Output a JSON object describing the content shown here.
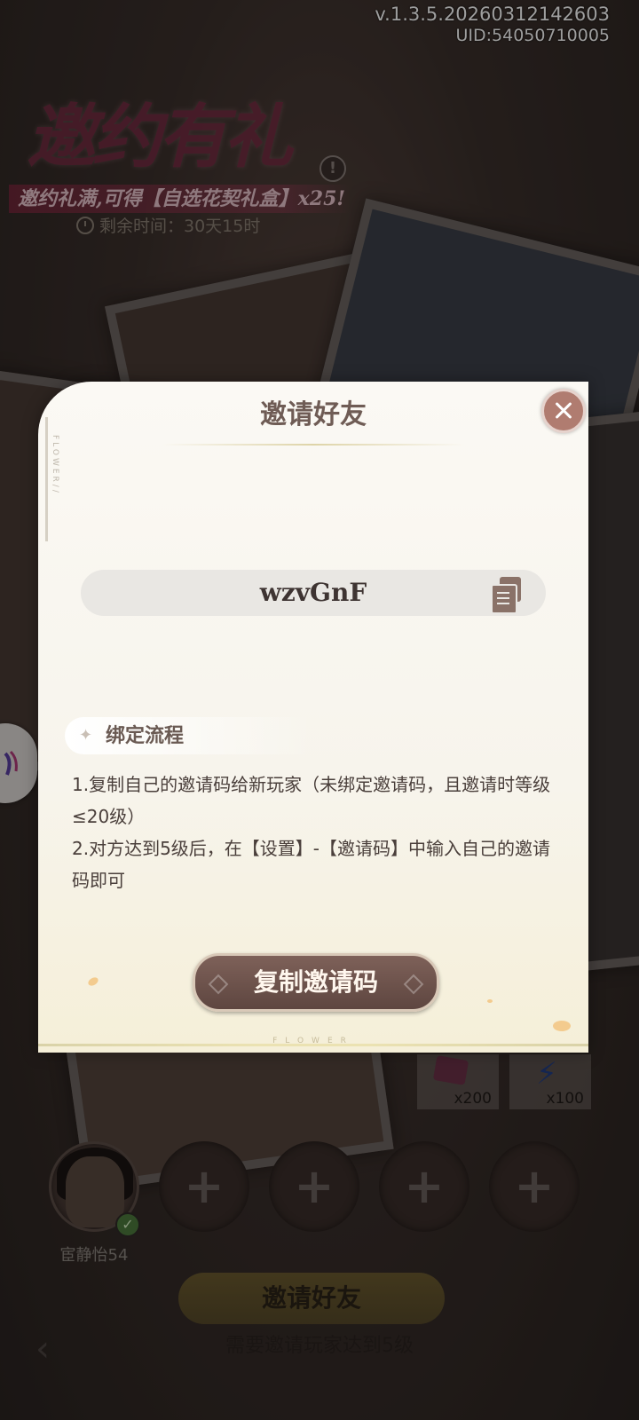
{
  "version": "v.1.3.5.20260312142603",
  "uid": "UID:54050710005",
  "event": {
    "title": "邀约有礼",
    "banner": "邀约礼满,可得【自选花契礼盒】x25!",
    "time_label": "剩余时间：30天15时",
    "alert": "!"
  },
  "rewards": [
    {
      "icon": "gem-icon",
      "qty": "x200"
    },
    {
      "icon": "energy-bolt-icon",
      "qty": "x100"
    }
  ],
  "player": {
    "name": "宦静怡54",
    "check": "✓"
  },
  "empty_slot_symbol": "+",
  "bottom": {
    "invite_label": "邀请好友",
    "note": "需要邀请玩家达到5级",
    "back_symbol": "‹"
  },
  "modal": {
    "title": "邀请好友",
    "side_mark": "FLOWER//",
    "footer_mark": "FLOWER",
    "invite_code": "wzvGnF",
    "section_title": "绑定流程",
    "section_icon": "✦",
    "steps": [
      "1.复制自己的邀请码给新玩家（未绑定邀请码，且邀请时等级≤20级）",
      " 2.对方达到5级后，在【设置】-【邀请码】中输入自己的邀请码即可"
    ],
    "copy_button_label": "复制邀请码"
  },
  "colors": {
    "modal_bg": "#fbf9f4",
    "button_brown": "#6e5149",
    "close_btn": "#b07c70",
    "title_text": "#6f5c55"
  }
}
